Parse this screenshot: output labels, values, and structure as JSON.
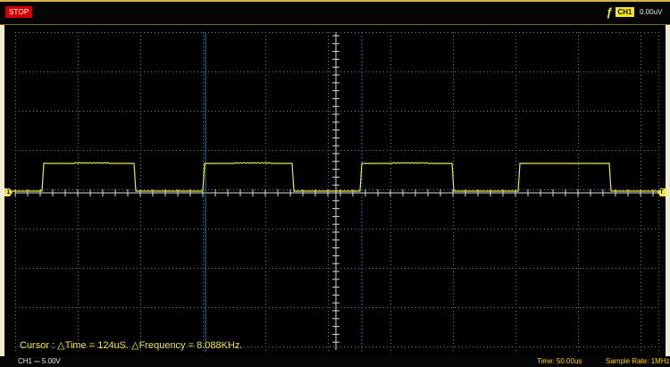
{
  "toolbar": {
    "run_state": "STOP",
    "trigger": {
      "icon": "edge-trigger-icon",
      "channel": "CH1",
      "level": "0.00uV"
    }
  },
  "markers": {
    "left": "1",
    "right": "T"
  },
  "cursor": {
    "label": "Cursor :",
    "delta_time": "124uS",
    "delta_frequency": "8.088KHz",
    "readout": "Cursor : △Time = 124uS. △Frequency = 8.088KHz."
  },
  "status": {
    "channel": "CH1",
    "coupling_symbol": "⎓",
    "volts_per_div": "5.00V",
    "channel_readout": "CH1 ⎓   5.00V",
    "time": "Time: 50.00us",
    "sample_rate": "Sample Rate: 1MHz"
  },
  "colors": {
    "trace": "#e9e84d",
    "cursor": "#1f77b4",
    "grid": "#7e7e7e",
    "stop_button": "#d10000",
    "highlight": "#f6e812"
  },
  "waveform": {
    "kind": "square pulse train",
    "vertical_scale": "5.00V/div",
    "time_scale": "50.00us/div"
  }
}
